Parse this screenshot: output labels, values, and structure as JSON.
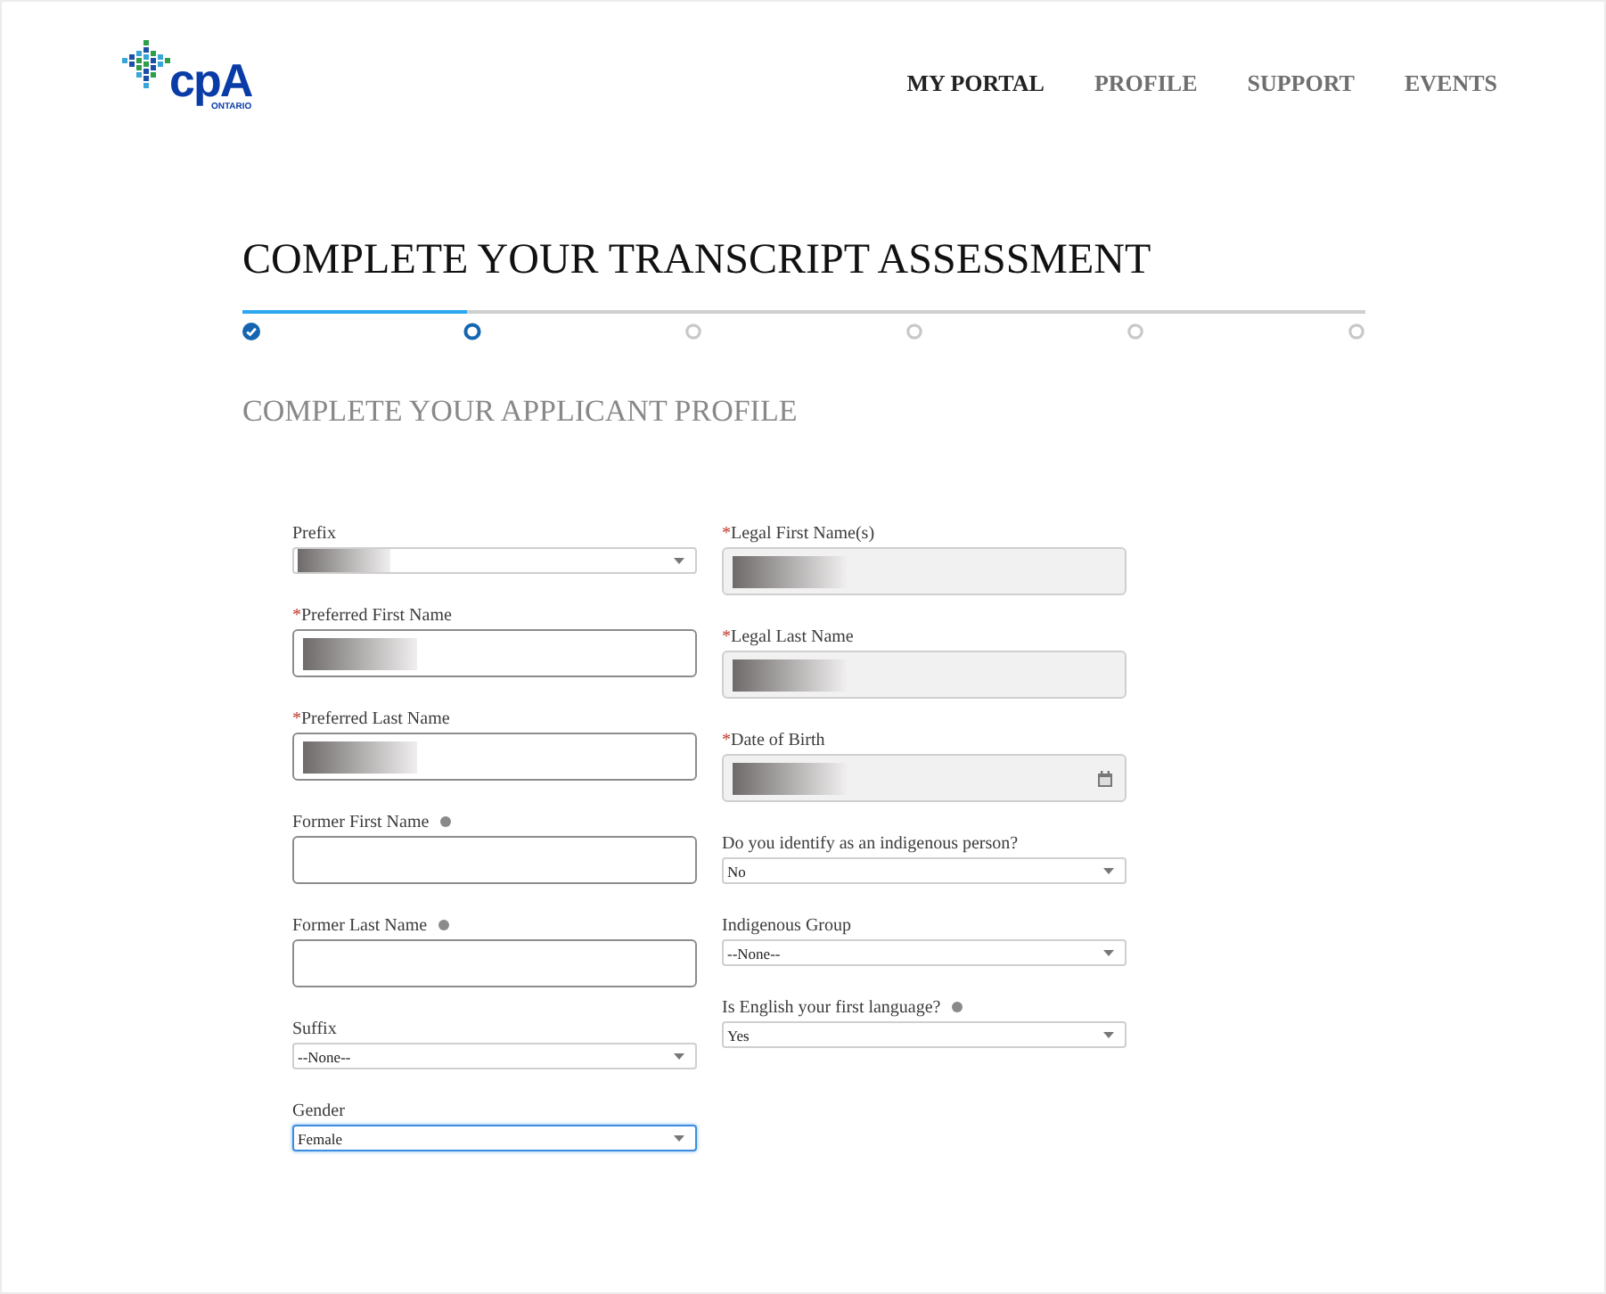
{
  "logo": {
    "name": "cpA",
    "region": "ONTARIO"
  },
  "nav": [
    {
      "label": "MY PORTAL",
      "selected": true
    },
    {
      "label": "PROFILE",
      "selected": false
    },
    {
      "label": "SUPPORT",
      "selected": false
    },
    {
      "label": "EVENTS",
      "selected": false
    }
  ],
  "title": "COMPLETE YOUR TRANSCRIPT ASSESSMENT",
  "stepper": {
    "level": 0.2,
    "steps": [
      {
        "completed": true,
        "selected": false
      },
      {
        "completed": false,
        "selected": true
      },
      {
        "completed": false,
        "selected": false
      },
      {
        "completed": false,
        "selected": false
      },
      {
        "completed": false,
        "selected": false
      },
      {
        "completed": false,
        "selected": false
      }
    ]
  },
  "subtitle": "COMPLETE YOUR APPLICANT PROFILE",
  "columns": [
    [
      {
        "kind": "select",
        "label": "Prefix",
        "info": false,
        "redacted": true,
        "disabled": false,
        "focused": false
      },
      {
        "kind": "text",
        "mark": "*",
        "label": "Preferred First Name",
        "info": false,
        "redacted": true,
        "disabled": false,
        "focused": false
      },
      {
        "kind": "text",
        "mark": "*",
        "label": "Preferred Last Name",
        "info": false,
        "redacted": true,
        "disabled": false,
        "focused": false
      },
      {
        "kind": "text",
        "label": "Former First Name",
        "info": true,
        "redacted": false,
        "disabled": false,
        "focused": false
      },
      {
        "kind": "text",
        "label": "Former Last Name",
        "info": true,
        "redacted": false,
        "disabled": false,
        "focused": false
      },
      {
        "kind": "select",
        "label": "Suffix",
        "value": "--None--",
        "info": false,
        "redacted": false,
        "disabled": false,
        "focused": false
      },
      {
        "kind": "select",
        "label": "Gender",
        "value": "Female",
        "info": false,
        "redacted": false,
        "disabled": false,
        "focused": true
      }
    ],
    [
      {
        "kind": "text",
        "mark": "*",
        "label": "Legal First Name(s)",
        "info": false,
        "redacted": true,
        "disabled": true,
        "focused": false
      },
      {
        "kind": "text",
        "mark": "*",
        "label": "Legal Last Name",
        "info": false,
        "redacted": true,
        "disabled": true,
        "focused": false
      },
      {
        "kind": "date",
        "mark": "*",
        "label": "Date of Birth",
        "info": false,
        "redacted": true,
        "disabled": true,
        "focused": false
      },
      {
        "kind": "select",
        "label": "Do you identify as an indigenous person?",
        "value": "No",
        "info": false,
        "redacted": false,
        "disabled": false,
        "focused": false
      },
      {
        "kind": "select",
        "label": "Indigenous Group",
        "value": "--None--",
        "info": false,
        "redacted": false,
        "disabled": false,
        "focused": false
      },
      {
        "kind": "select",
        "label": "Is English your first language?",
        "value": "Yes",
        "info": true,
        "redacted": false,
        "disabled": false,
        "focused": false
      }
    ]
  ]
}
